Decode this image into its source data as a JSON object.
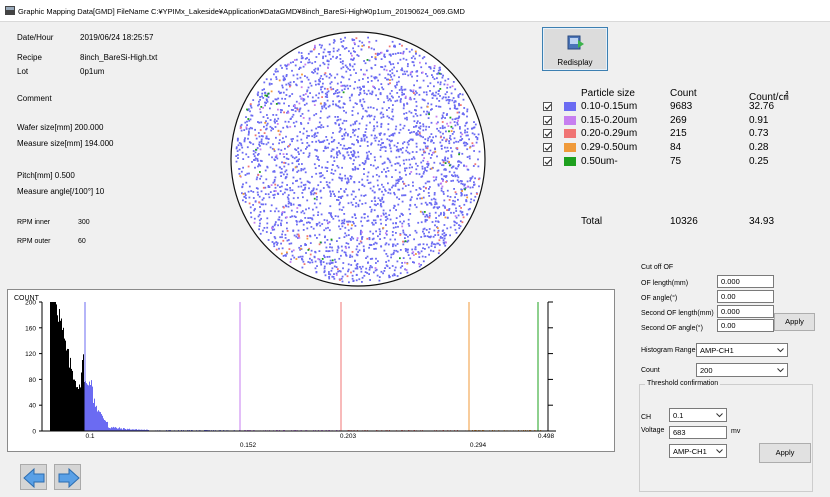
{
  "window": {
    "title": "Graphic Mapping Data[GMD] FileName C:¥YPIMx_Lakeside¥Application¥DataGMD¥8inch_BareSi-High¥0p1um_20190624_069.GMD"
  },
  "info": {
    "date_label": "Date/Hour",
    "date_value": "2019/06/24 18:25:57",
    "recipe_label": "Recipe",
    "recipe_value": "8inch_BareSi-High.txt",
    "lot_label": "Lot",
    "lot_value": "0p1um",
    "comment_label": "Comment",
    "wafer_size": "Wafer size[mm] 200.000",
    "measure_size": "Measure size[mm] 194.000",
    "pitch": "Pitch[mm] 0.500",
    "measure_angle": "Measure angle[/100°] 10",
    "rpm_inner_label": "RPM inner",
    "rpm_inner_value": "300",
    "rpm_outer_label": "RPM outer",
    "rpm_outer_value": "60"
  },
  "redisplay": {
    "label": "Redisplay"
  },
  "legend": {
    "headers": {
      "size": "Particle size",
      "count": "Count",
      "density": "Count/㎠"
    },
    "rows": [
      {
        "label": "0.10-0.15um",
        "count": "9683",
        "density": "32.76",
        "color": "#6b6bf2",
        "checked": true
      },
      {
        "label": "0.15-0.20um",
        "count": "269",
        "density": "0.91",
        "color": "#c77ef0",
        "checked": true
      },
      {
        "label": "0.20-0.29um",
        "count": "215",
        "density": "0.73",
        "color": "#f07474",
        "checked": true
      },
      {
        "label": "0.29-0.50um",
        "count": "84",
        "density": "0.28",
        "color": "#f09a3a",
        "checked": true
      },
      {
        "label": "0.50um-",
        "count": "75",
        "density": "0.25",
        "color": "#1ea01e",
        "checked": true
      }
    ],
    "total_label": "Total",
    "total_count": "10326",
    "total_density": "34.93"
  },
  "cutoff": {
    "title": "Cut off OF",
    "of_length_label": "OF length(mm)",
    "of_length_value": "0.000",
    "of_angle_label": "OF angle(°)",
    "of_angle_value": "0.00",
    "second_length_label": "Second OF length(mm)",
    "second_length_value": "0.000",
    "second_angle_label": "Second OF angle(°)",
    "second_angle_value": "0.00",
    "apply_label": "Apply"
  },
  "histogram_controls": {
    "range_label": "Histogram Range",
    "range_value": "AMP-CH1",
    "count_label": "Count",
    "count_value": "200"
  },
  "threshold": {
    "title": "Threshold confirmation",
    "ch_label": "CH",
    "ch_value": "0.1",
    "voltage_label": "Voltage",
    "voltage_value": "683",
    "voltage_unit": "mv",
    "amp_value": "AMP-CH1",
    "apply_label": "Apply"
  },
  "chart_data": {
    "type": "bar",
    "ylabel": "COUNT",
    "ylim": [
      0,
      200
    ],
    "y_ticks": [
      "200",
      "160",
      "120",
      "80",
      "40",
      "0"
    ],
    "x_tick_labels": [
      "0.1",
      "0.152",
      "0.203",
      "0.294",
      "0.498"
    ],
    "thresholds": [
      {
        "value": "0.1",
        "color": "#6b6bf2"
      },
      {
        "value": "0.152",
        "color": "#c77ef0"
      },
      {
        "value": "0.203",
        "color": "#f07474"
      },
      {
        "value": "0.294",
        "color": "#f09a3a"
      },
      {
        "value": "0.498",
        "color": "#1ea01e"
      }
    ],
    "series": [
      {
        "name": "below threshold",
        "color": "#000000"
      },
      {
        "name": "0.10-0.15um",
        "color": "#6b6bf2"
      }
    ]
  },
  "icons": {
    "back": "arrow-left-icon",
    "forward": "arrow-right-icon",
    "app": "app-icon",
    "redisplay": "redisplay-icon"
  }
}
